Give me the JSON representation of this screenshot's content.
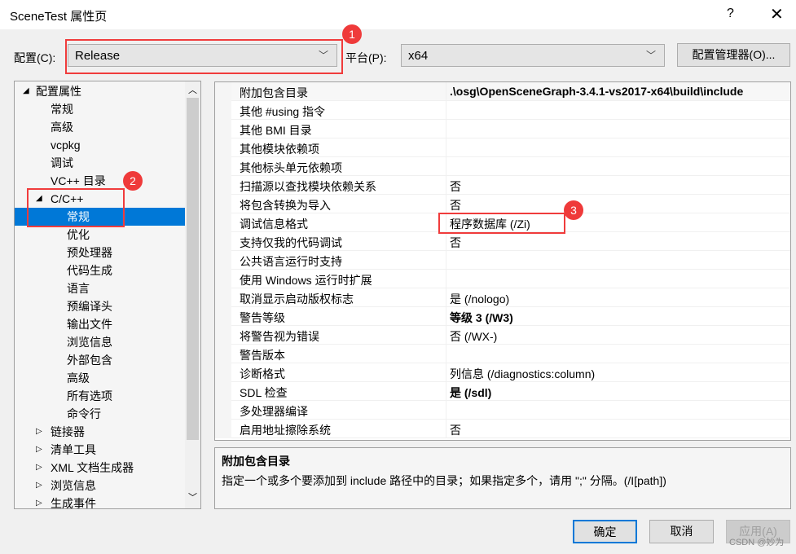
{
  "window": {
    "title": "SceneTest 属性页",
    "help": "?",
    "close": "✕"
  },
  "config": {
    "label": "配置(C):",
    "value": "Release",
    "platform_label": "平台(P):",
    "platform_value": "x64",
    "manager_button": "配置管理器(O)..."
  },
  "tree": [
    {
      "label": "配置属性",
      "level": 0,
      "expander": "expanded"
    },
    {
      "label": "常规",
      "level": 1
    },
    {
      "label": "高级",
      "level": 1
    },
    {
      "label": "vcpkg",
      "level": 1
    },
    {
      "label": "调试",
      "level": 1
    },
    {
      "label": "VC++ 目录",
      "level": 1
    },
    {
      "label": "C/C++",
      "level": 1,
      "expander": "expanded"
    },
    {
      "label": "常规",
      "level": 2,
      "selected": true
    },
    {
      "label": "优化",
      "level": 2
    },
    {
      "label": "预处理器",
      "level": 2
    },
    {
      "label": "代码生成",
      "level": 2
    },
    {
      "label": "语言",
      "level": 2
    },
    {
      "label": "预编译头",
      "level": 2
    },
    {
      "label": "输出文件",
      "level": 2
    },
    {
      "label": "浏览信息",
      "level": 2
    },
    {
      "label": "外部包含",
      "level": 2
    },
    {
      "label": "高级",
      "level": 2
    },
    {
      "label": "所有选项",
      "level": 2
    },
    {
      "label": "命令行",
      "level": 2
    },
    {
      "label": "链接器",
      "level": 1,
      "expander": "collapsed"
    },
    {
      "label": "清单工具",
      "level": 1,
      "expander": "collapsed"
    },
    {
      "label": "XML 文档生成器",
      "level": 1,
      "expander": "collapsed"
    },
    {
      "label": "浏览信息",
      "level": 1,
      "expander": "collapsed"
    },
    {
      "label": "生成事件",
      "level": 1,
      "expander": "collapsed"
    }
  ],
  "properties": [
    {
      "name": "附加包含目录",
      "value": ".\\osg\\OpenSceneGraph-3.4.1-vs2017-x64\\build\\include",
      "bold": true
    },
    {
      "name": "其他 #using 指令",
      "value": ""
    },
    {
      "name": "其他 BMI 目录",
      "value": ""
    },
    {
      "name": "其他模块依赖项",
      "value": ""
    },
    {
      "name": "其他标头单元依赖项",
      "value": ""
    },
    {
      "name": "扫描源以查找模块依赖关系",
      "value": "否"
    },
    {
      "name": "将包含转换为导入",
      "value": "否"
    },
    {
      "name": "调试信息格式",
      "value": "程序数据库 (/Zi)"
    },
    {
      "name": "支持仅我的代码调试",
      "value": "否"
    },
    {
      "name": "公共语言运行时支持",
      "value": ""
    },
    {
      "name": "使用 Windows 运行时扩展",
      "value": ""
    },
    {
      "name": "取消显示启动版权标志",
      "value": "是 (/nologo)"
    },
    {
      "name": "警告等级",
      "value": "等级 3 (/W3)",
      "bold": true
    },
    {
      "name": "将警告视为错误",
      "value": "否 (/WX-)"
    },
    {
      "name": "警告版本",
      "value": ""
    },
    {
      "name": "诊断格式",
      "value": "列信息 (/diagnostics:column)"
    },
    {
      "name": "SDL 检查",
      "value": "是 (/sdl)",
      "bold": true
    },
    {
      "name": "多处理器编译",
      "value": ""
    },
    {
      "name": "启用地址擦除系统",
      "value": "否"
    }
  ],
  "description": {
    "title": "附加包含目录",
    "text": "指定一个或多个要添加到 include 路径中的目录；如果指定多个，请用 \";\" 分隔。(/I[path])"
  },
  "buttons": {
    "ok": "确定",
    "cancel": "取消",
    "apply": "应用(A)"
  },
  "annotations": [
    "1",
    "2",
    "3"
  ],
  "watermark": "CSDN @妙为",
  "colors": {
    "selection": "#0078d7",
    "annotation": "#ef3a3a"
  }
}
